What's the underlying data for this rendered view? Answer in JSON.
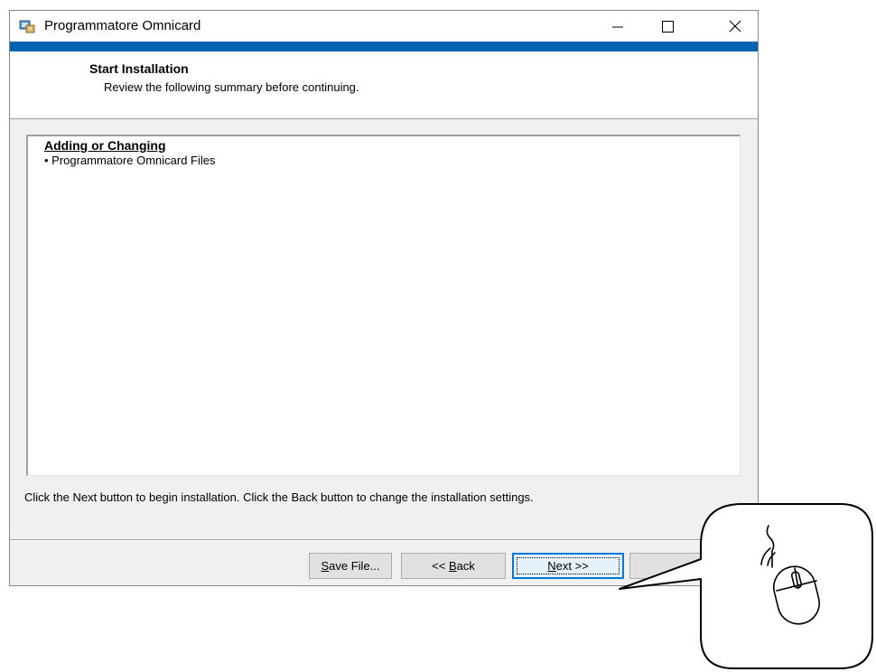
{
  "window": {
    "title": "Programmatore Omnicard",
    "icons": {
      "app": "installer-app-icon",
      "minimize": "minimize-icon",
      "maximize": "maximize-icon",
      "close": "close-icon"
    }
  },
  "header": {
    "title": "Start Installation",
    "subtitle": "Review the following summary before continuing."
  },
  "summary": {
    "heading": "Adding or Changing",
    "items": [
      "• Programmatore Omnicard Files"
    ]
  },
  "instruction": "Click the Next button to begin installation.  Click the Back button to change the installation settings.",
  "buttons": {
    "save_mnemonic": "S",
    "save_rest": "ave File...",
    "back_prefix": "<< ",
    "back_mnemonic": "B",
    "back_rest": "ack",
    "next_mnemonic": "N",
    "next_rest": "ext >>"
  },
  "callout": {
    "icon": "mouse-click-icon"
  },
  "colors": {
    "accent": "#0063b1",
    "focus": "#0078d7",
    "window_bg": "#f0f0f0"
  }
}
